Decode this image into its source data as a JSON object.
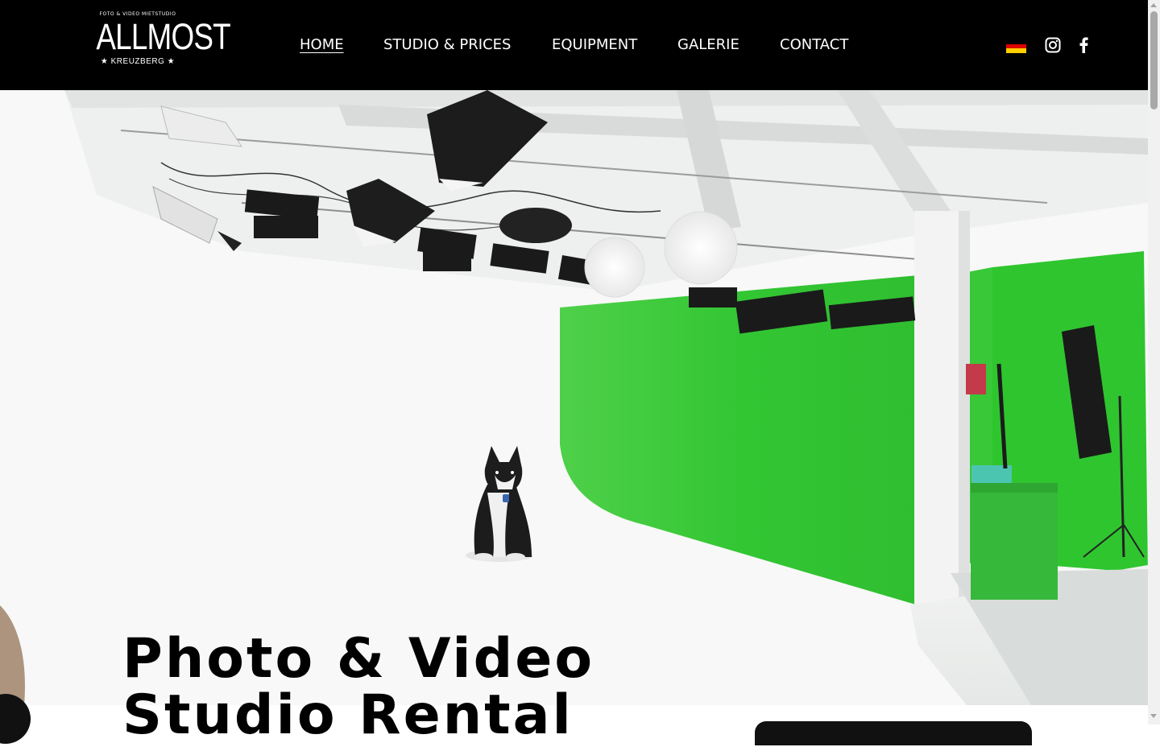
{
  "brand": {
    "top_line": "FOTO & VIDEO MIETSTUDIO",
    "name": "ALLMOST",
    "sub_line": "★ KREUZBERG ★"
  },
  "nav": {
    "items": [
      {
        "label": "HOME",
        "active": true
      },
      {
        "label": "STUDIO & PRICES",
        "active": false
      },
      {
        "label": "EQUIPMENT",
        "active": false
      },
      {
        "label": "GALERIE",
        "active": false
      },
      {
        "label": "CONTACT",
        "active": false
      }
    ]
  },
  "header_icons": {
    "language": "german-flag-icon",
    "instagram": "instagram-icon",
    "facebook": "facebook-icon"
  },
  "hero": {
    "headline": "Photo & Video Studio Rental",
    "image": "studio-photo-white-cyclorama-green-screen-husky-dog"
  },
  "colors": {
    "nav_background": "#000000",
    "nav_text": "#ffffff",
    "green_screen": "#33cc33",
    "headline_text": "#000000"
  }
}
